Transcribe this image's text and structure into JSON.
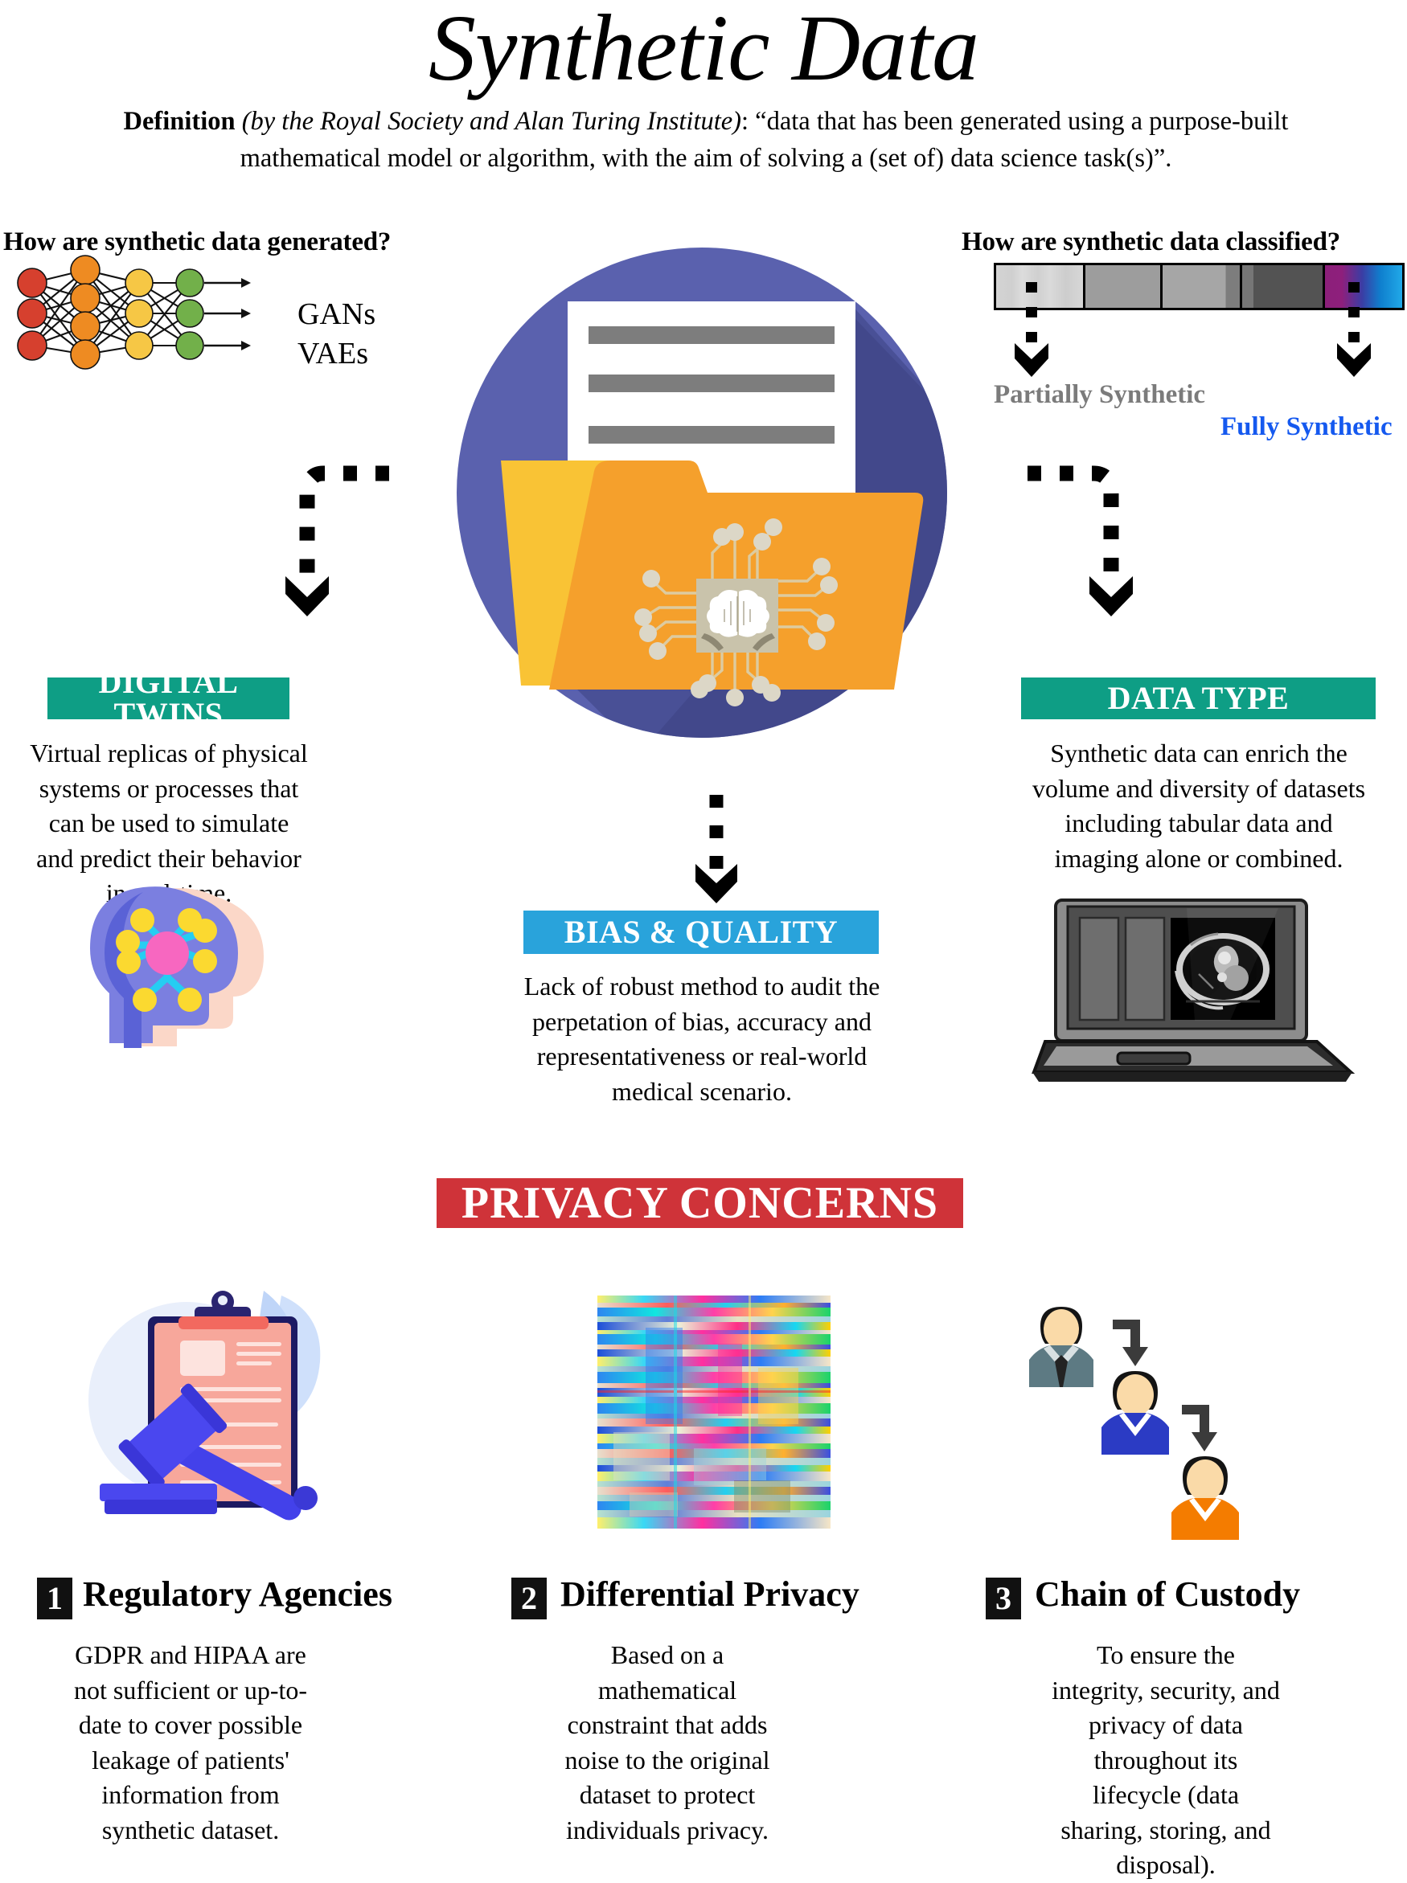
{
  "title": "Synthetic Data",
  "definition": {
    "label": "Definition",
    "source": "(by the Royal Society and Alan Turing Institute)",
    "quote": ": “data that has been generated using a purpose-built mathematical model or algorithm, with the aim of solving a (set of) data science task(s)”."
  },
  "left_question": {
    "heading": "How are synthetic data generated?",
    "methods": [
      "GANs",
      "VAEs"
    ],
    "network_colors": {
      "input": "#d6402e",
      "hidden1": "#ee8b22",
      "hidden2": "#f6c745",
      "output": "#72b04a"
    }
  },
  "right_question": {
    "heading": "How are synthetic data classified?",
    "left_label": "Partially Synthetic",
    "right_label": "Fully Synthetic",
    "left_label_color": "#7b7b7b",
    "right_label_color": "#1559ef"
  },
  "center_icon": {
    "name": "document-folder-ai-circle",
    "circle_color": "#5a61ae",
    "shadow_color": "#3a3f7e",
    "folder_back_color": "#f9c335",
    "folder_front_color": "#f5a02c",
    "paper_color": "#ffffff",
    "paper_line_color": "#7d7d7d",
    "chip_color": "#c9c3ab"
  },
  "panels": [
    {
      "id": "digital-twins",
      "title": "DIGITAL TWINS",
      "banner_color": "#0e9e85",
      "text": "Virtual replicas of physical systems or processes that can be used to simulate and predict their behavior in real-time.",
      "icon": "head-brain-network-icon"
    },
    {
      "id": "bias-quality",
      "title": "BIAS & QUALITY",
      "banner_color": "#29a3db",
      "text": "Lack of robust method to audit the perpetation of bias, accuracy and representativeness or real-world medical scenario.",
      "icon": "none"
    },
    {
      "id": "data-type",
      "title": "DATA TYPE",
      "banner_color": "#0e9e85",
      "text": "Synthetic data can enrich the volume and diversity of datasets including tabular data and imaging alone or combined.",
      "icon": "laptop-ct-scan-icon"
    }
  ],
  "privacy": {
    "banner": "PRIVACY CONCERNS",
    "banner_color": "#cf3339",
    "items": [
      {
        "number": "1",
        "title": "Regulatory Agencies",
        "text": "GDPR and HIPAA are not sufficient or up-to-date to cover possible leakage of patients' information from synthetic dataset.",
        "icon": "gavel-clipboard-icon"
      },
      {
        "number": "2",
        "title": "Differential Privacy",
        "text": "Based on a mathematical constraint that adds noise to the original dataset to protect individuals privacy.",
        "icon": "glitch-noise-image-icon"
      },
      {
        "number": "3",
        "title": "Chain of Custody",
        "text": "To ensure the integrity, security, and privacy of data throughout its lifecycle (data sharing, storing, and disposal).",
        "icon": "people-chain-flow-icon"
      }
    ]
  }
}
